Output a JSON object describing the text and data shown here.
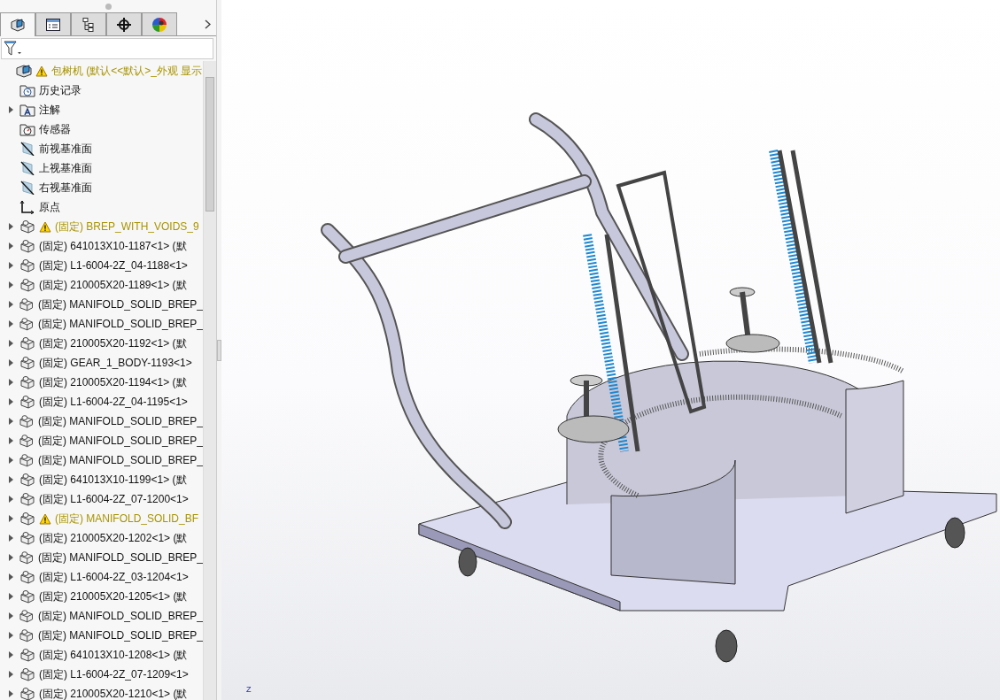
{
  "panel": {
    "tabs": [
      {
        "kind": "features",
        "selected": true
      },
      {
        "kind": "properties",
        "selected": false
      },
      {
        "kind": "configurations",
        "selected": false
      },
      {
        "kind": "dimxpert",
        "selected": false
      },
      {
        "kind": "appearance",
        "selected": false
      }
    ],
    "tree": [
      {
        "label": "包树机  (默认<<默认>_外观 显示",
        "kind": "assembly",
        "warning": true,
        "expandable": false,
        "children": [
          {
            "label": "历史记录",
            "kind": "history",
            "warning": false,
            "expandable": false
          },
          {
            "label": "注解",
            "kind": "annotations",
            "warning": false,
            "expandable": true
          },
          {
            "label": "传感器",
            "kind": "sensors",
            "warning": false,
            "expandable": false
          },
          {
            "label": "前视基准面",
            "kind": "plane",
            "warning": false,
            "expandable": false
          },
          {
            "label": "上视基准面",
            "kind": "plane",
            "warning": false,
            "expandable": false
          },
          {
            "label": "右视基准面",
            "kind": "plane",
            "warning": false,
            "expandable": false
          },
          {
            "label": "原点",
            "kind": "origin",
            "warning": false,
            "expandable": false
          },
          {
            "label": "(固定) BREP_WITH_VOIDS_9",
            "kind": "part",
            "warning": true,
            "expandable": true
          },
          {
            "label": "(固定) 641013X10-1187<1> (默",
            "kind": "part",
            "warning": false,
            "expandable": true
          },
          {
            "label": "(固定) L1-6004-2Z_04-1188<1>",
            "kind": "part",
            "warning": false,
            "expandable": true
          },
          {
            "label": "(固定) 210005X20-1189<1> (默",
            "kind": "part",
            "warning": false,
            "expandable": true
          },
          {
            "label": "(固定) MANIFOLD_SOLID_BREP_",
            "kind": "part",
            "warning": false,
            "expandable": true
          },
          {
            "label": "(固定) MANIFOLD_SOLID_BREP_",
            "kind": "part",
            "warning": false,
            "expandable": true
          },
          {
            "label": "(固定) 210005X20-1192<1> (默",
            "kind": "part",
            "warning": false,
            "expandable": true
          },
          {
            "label": "(固定) GEAR_1_BODY-1193<1>",
            "kind": "part",
            "warning": false,
            "expandable": true
          },
          {
            "label": "(固定) 210005X20-1194<1> (默",
            "kind": "part",
            "warning": false,
            "expandable": true
          },
          {
            "label": "(固定) L1-6004-2Z_04-1195<1>",
            "kind": "part",
            "warning": false,
            "expandable": true
          },
          {
            "label": "(固定) MANIFOLD_SOLID_BREP_",
            "kind": "part",
            "warning": false,
            "expandable": true
          },
          {
            "label": "(固定) MANIFOLD_SOLID_BREP_",
            "kind": "part",
            "warning": false,
            "expandable": true
          },
          {
            "label": "(固定) MANIFOLD_SOLID_BREP_",
            "kind": "part",
            "warning": false,
            "expandable": true
          },
          {
            "label": "(固定) 641013X10-1199<1> (默",
            "kind": "part",
            "warning": false,
            "expandable": true
          },
          {
            "label": "(固定) L1-6004-2Z_07-1200<1>",
            "kind": "part",
            "warning": false,
            "expandable": true
          },
          {
            "label": "(固定) MANIFOLD_SOLID_BF",
            "kind": "part",
            "warning": true,
            "expandable": true
          },
          {
            "label": "(固定) 210005X20-1202<1> (默",
            "kind": "part",
            "warning": false,
            "expandable": true
          },
          {
            "label": "(固定) MANIFOLD_SOLID_BREP_",
            "kind": "part",
            "warning": false,
            "expandable": true
          },
          {
            "label": "(固定) L1-6004-2Z_03-1204<1>",
            "kind": "part",
            "warning": false,
            "expandable": true
          },
          {
            "label": "(固定) 210005X20-1205<1> (默",
            "kind": "part",
            "warning": false,
            "expandable": true
          },
          {
            "label": "(固定) MANIFOLD_SOLID_BREP_",
            "kind": "part",
            "warning": false,
            "expandable": true
          },
          {
            "label": "(固定) MANIFOLD_SOLID_BREP_",
            "kind": "part",
            "warning": false,
            "expandable": true
          },
          {
            "label": "(固定) 641013X10-1208<1> (默",
            "kind": "part",
            "warning": false,
            "expandable": true
          },
          {
            "label": "(固定) L1-6004-2Z_07-1209<1>",
            "kind": "part",
            "warning": false,
            "expandable": true
          },
          {
            "label": "(固定) 210005X20-1210<1> (默",
            "kind": "part",
            "warning": false,
            "expandable": true
          }
        ]
      }
    ]
  },
  "viewport": {
    "triad_label": "Z"
  }
}
